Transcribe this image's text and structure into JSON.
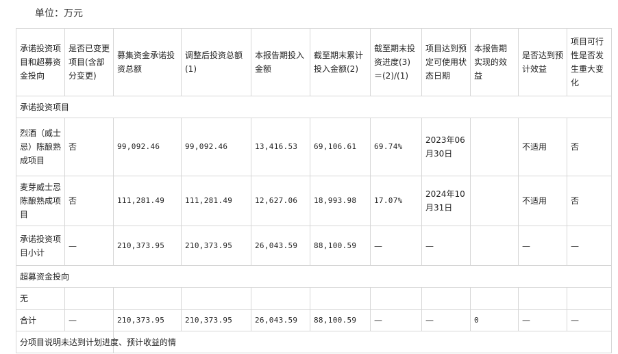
{
  "unit_label": "单位：万元",
  "headers": [
    "承诺投资项目和超募资金投向",
    "是否已变更项目(含部分变更)",
    "募集资金承诺投资总额",
    "调整后投资总额(1)",
    "本报告期投入金额",
    "截至期末累计投入金额(2)",
    "截至期末投资进度(3)＝(2)/(1)",
    "项目达到预定可使用状态日期",
    "本报告期实现的效益",
    "是否达到预计效益",
    "项目可行性是否发生重大变化"
  ],
  "section_committed": "承诺投资项目",
  "rows": [
    {
      "name": "烈酒（威士忌）陈酿熟成项目",
      "changed": "否",
      "committed_total": "99,092.46",
      "adjusted_total": "99,092.46",
      "period_input": "13,416.53",
      "cumulative_input": "69,106.61",
      "progress": "69.74%",
      "ready_date": "2023年06月30日",
      "period_benefit": "",
      "benefit_met": "不适用",
      "feasibility_change": "否"
    },
    {
      "name": "麦芽威士忌陈酿熟成项目",
      "changed": "否",
      "committed_total": "111,281.49",
      "adjusted_total": "111,281.49",
      "period_input": "12,627.06",
      "cumulative_input": "18,993.98",
      "progress": "17.07%",
      "ready_date": "2024年10月31日",
      "period_benefit": "",
      "benefit_met": "不适用",
      "feasibility_change": "否"
    },
    {
      "name": "承诺投资项目小计",
      "changed": "—",
      "committed_total": "210,373.95",
      "adjusted_total": "210,373.95",
      "period_input": "26,043.59",
      "cumulative_input": "88,100.59",
      "progress": "—",
      "ready_date": "—",
      "period_benefit": "",
      "benefit_met": "—",
      "feasibility_change": "—"
    }
  ],
  "section_overraised": "超募资金投向",
  "none_row_label": "无",
  "total_row": {
    "name": "合计",
    "changed": "—",
    "committed_total": "210,373.95",
    "adjusted_total": "210,373.95",
    "period_input": "26,043.59",
    "cumulative_input": "88,100.59",
    "progress": "—",
    "ready_date": "—",
    "period_benefit": "0",
    "benefit_met": "—",
    "feasibility_change": "—"
  },
  "bottom_row_text": "分项目说明未达到计划进度、预计收益的情"
}
